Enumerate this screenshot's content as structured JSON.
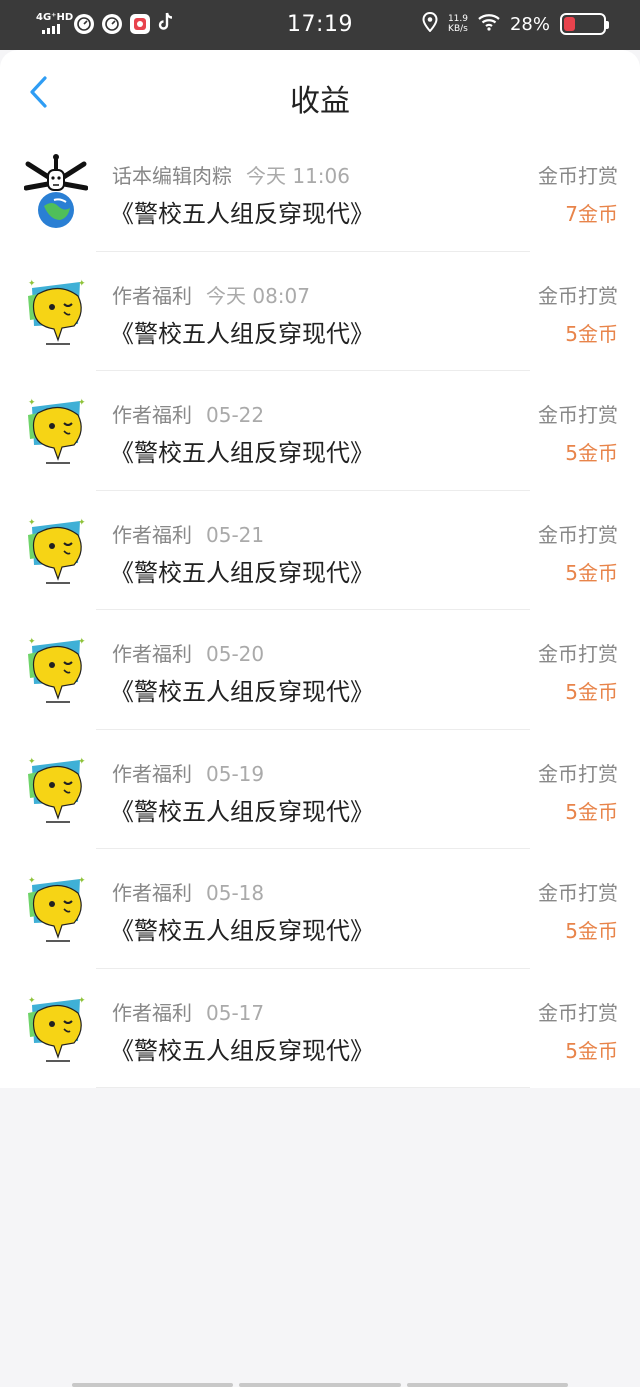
{
  "status_bar": {
    "network": "4G⁺HD",
    "time": "17:19",
    "speed_value": "11.9",
    "speed_unit": "KB/s",
    "battery": "28%",
    "battery_level": 0.28
  },
  "header": {
    "title": "收益"
  },
  "colors": {
    "amount": "#e8844a",
    "back_arrow": "#2f9df4"
  },
  "items": [
    {
      "sender": "话本编辑肉粽",
      "time": "今天 11:06",
      "book": "《警校五人组反穿现代》",
      "type": "金币打赏",
      "amount": "7金币",
      "avatar": "skull-globe-avatar"
    },
    {
      "sender": "作者福利",
      "time": "今天 08:07",
      "book": "《警校五人组反穿现代》",
      "type": "金币打赏",
      "amount": "5金币",
      "avatar": "yellow-face-avatar"
    },
    {
      "sender": "作者福利",
      "time": "05-22",
      "book": "《警校五人组反穿现代》",
      "type": "金币打赏",
      "amount": "5金币",
      "avatar": "yellow-face-avatar"
    },
    {
      "sender": "作者福利",
      "time": "05-21",
      "book": "《警校五人组反穿现代》",
      "type": "金币打赏",
      "amount": "5金币",
      "avatar": "yellow-face-avatar"
    },
    {
      "sender": "作者福利",
      "time": "05-20",
      "book": "《警校五人组反穿现代》",
      "type": "金币打赏",
      "amount": "5金币",
      "avatar": "yellow-face-avatar"
    },
    {
      "sender": "作者福利",
      "time": "05-19",
      "book": "《警校五人组反穿现代》",
      "type": "金币打赏",
      "amount": "5金币",
      "avatar": "yellow-face-avatar"
    },
    {
      "sender": "作者福利",
      "time": "05-18",
      "book": "《警校五人组反穿现代》",
      "type": "金币打赏",
      "amount": "5金币",
      "avatar": "yellow-face-avatar"
    },
    {
      "sender": "作者福利",
      "time": "05-17",
      "book": "《警校五人组反穿现代》",
      "type": "金币打赏",
      "amount": "5金币",
      "avatar": "yellow-face-avatar"
    }
  ]
}
